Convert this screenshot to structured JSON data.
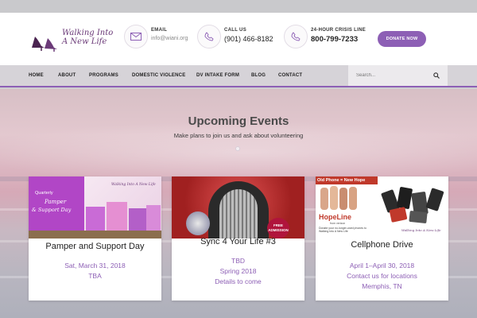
{
  "brand": {
    "logo_text": "Walking Into A New Life"
  },
  "contacts": [
    {
      "label": "EMAIL",
      "value": "info@wiani.org",
      "icon": "envelope-icon"
    },
    {
      "label": "CALL US",
      "value": "(901) 466-8182",
      "icon": "phone-icon"
    },
    {
      "label": "24-HOUR CRISIS LINE",
      "value": "800-799-7233",
      "icon": "phone-icon"
    }
  ],
  "donate_label": "DONATE NOW",
  "nav": {
    "items": [
      "HOME",
      "ABOUT",
      "PROGRAMS",
      "DOMESTIC VIOLENCE",
      "DV INTAKE FORM",
      "BLOG",
      "CONTACT"
    ],
    "search_placeholder": "Search..."
  },
  "events": {
    "title": "Upcoming Events",
    "subtitle": "Make plans to join us and ask about volunteering",
    "cards": [
      {
        "title": "Pamper and Support Day",
        "lines": [
          "Sat, March 31, 2018",
          "TBA"
        ],
        "thumb": {
          "kicker": "Quarterly",
          "headline_1": "Pamper",
          "headline_2": "& Support Day",
          "brand": "Walking Into A New Life"
        }
      },
      {
        "title": "Sync 4 Your Life #3",
        "lines": [
          "TBD",
          "Spring 2018",
          "Details to come"
        ],
        "thumb": {
          "badge_1": "FREE",
          "badge_2": "ADMISSION"
        }
      },
      {
        "title": "Cellphone Drive",
        "lines": [
          "April 1–April 30, 2018",
          "Contact us for locations",
          "Memphis, TN"
        ],
        "thumb": {
          "banner": "Old Phone = New Hope",
          "logo": "HopeLine",
          "logo_sub": "from verizon",
          "body": "Donate your no-longer-used phones to Walking Into A New Life",
          "brand": "Walking Into A New Life"
        }
      }
    ]
  },
  "colors": {
    "accent": "#8d5fb5",
    "thumb1": "#b146c6",
    "banner_red": "#c0392b"
  }
}
